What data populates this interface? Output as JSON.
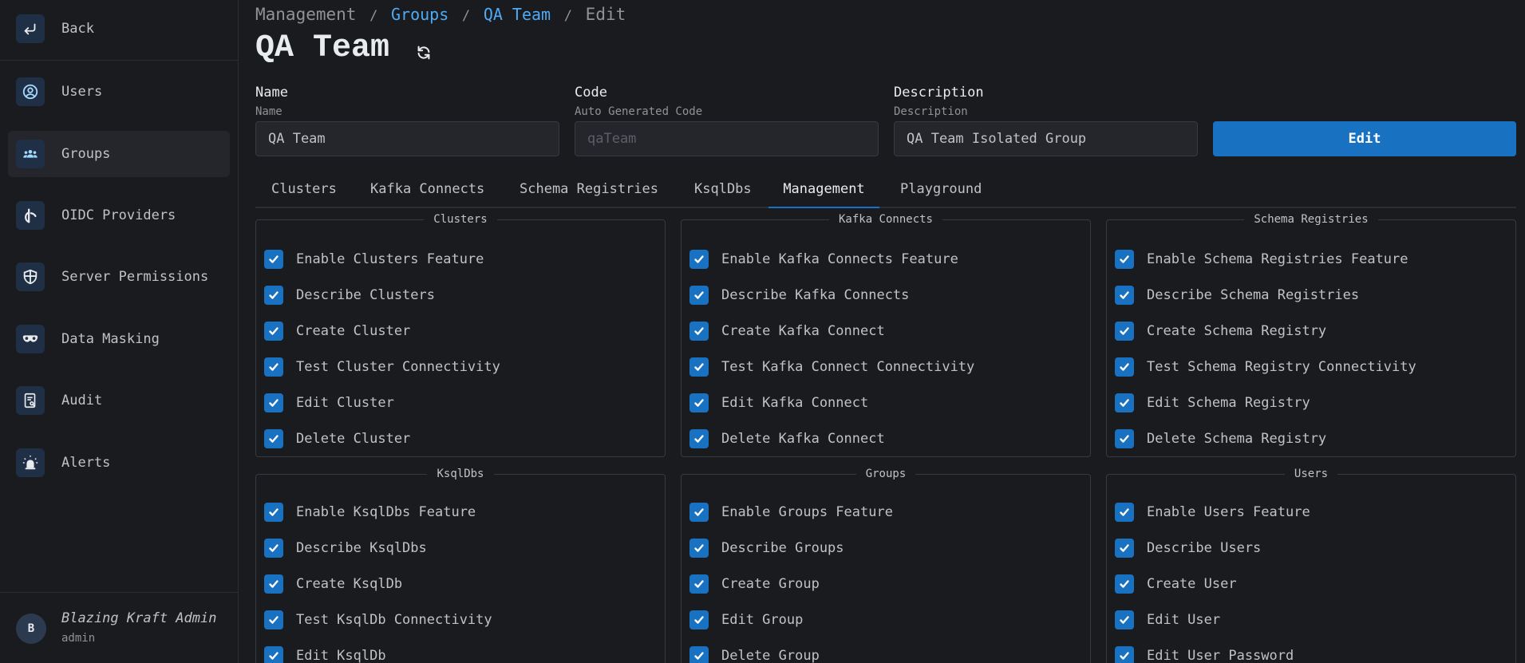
{
  "sidebar": {
    "back_label": "Back",
    "items": [
      {
        "label": "Users",
        "icon": "user-circle-icon"
      },
      {
        "label": "Groups",
        "icon": "users-group-icon"
      },
      {
        "label": "OIDC Providers",
        "icon": "oidc-icon"
      },
      {
        "label": "Server Permissions",
        "icon": "shield-icon"
      },
      {
        "label": "Data Masking",
        "icon": "mask-icon"
      },
      {
        "label": "Audit",
        "icon": "report-icon"
      },
      {
        "label": "Alerts",
        "icon": "alarm-icon"
      }
    ],
    "active_item": "Groups",
    "user": {
      "initial": "B",
      "name": "Blazing Kraft Admin",
      "role": "admin"
    }
  },
  "breadcrumb": {
    "root": "Management",
    "sep": "/",
    "groups": "Groups",
    "current_group": "QA Team",
    "action": "Edit"
  },
  "page_title": "QA Team",
  "form": {
    "name": {
      "label": "Name",
      "sub": "Name",
      "value": "QA Team"
    },
    "code": {
      "label": "Code",
      "sub": "Auto Generated Code",
      "value": "qaTeam"
    },
    "description": {
      "label": "Description",
      "sub": "Description",
      "value": "QA Team Isolated Group"
    },
    "edit_label": "Edit"
  },
  "tabs": [
    "Clusters",
    "Kafka Connects",
    "Schema Registries",
    "KsqlDbs",
    "Management",
    "Playground"
  ],
  "active_tab": "Management",
  "permissions": {
    "clusters": {
      "title": "Clusters",
      "items": [
        "Enable Clusters Feature",
        "Describe Clusters",
        "Create Cluster",
        "Test Cluster Connectivity",
        "Edit Cluster",
        "Delete Cluster"
      ]
    },
    "kafka_connects": {
      "title": "Kafka Connects",
      "items": [
        "Enable Kafka Connects Feature",
        "Describe Kafka Connects",
        "Create Kafka Connect",
        "Test Kafka Connect Connectivity",
        "Edit Kafka Connect",
        "Delete Kafka Connect"
      ]
    },
    "schema_registries": {
      "title": "Schema Registries",
      "items": [
        "Enable Schema Registries Feature",
        "Describe Schema Registries",
        "Create Schema Registry",
        "Test Schema Registry Connectivity",
        "Edit Schema Registry",
        "Delete Schema Registry"
      ]
    },
    "ksqldbs": {
      "title": "KsqlDbs",
      "items": [
        "Enable KsqlDbs Feature",
        "Describe KsqlDbs",
        "Create KsqlDb",
        "Test KsqlDb Connectivity",
        "Edit KsqlDb"
      ]
    },
    "groups": {
      "title": "Groups",
      "items": [
        "Enable Groups Feature",
        "Describe Groups",
        "Create Group",
        "Edit Group",
        "Delete Group"
      ]
    },
    "users": {
      "title": "Users",
      "items": [
        "Enable Users Feature",
        "Describe Users",
        "Create User",
        "Edit User",
        "Edit User Password"
      ]
    }
  },
  "colors": {
    "accent": "#1971c2",
    "link": "#4dabf7",
    "background": "#1a1b1e"
  }
}
